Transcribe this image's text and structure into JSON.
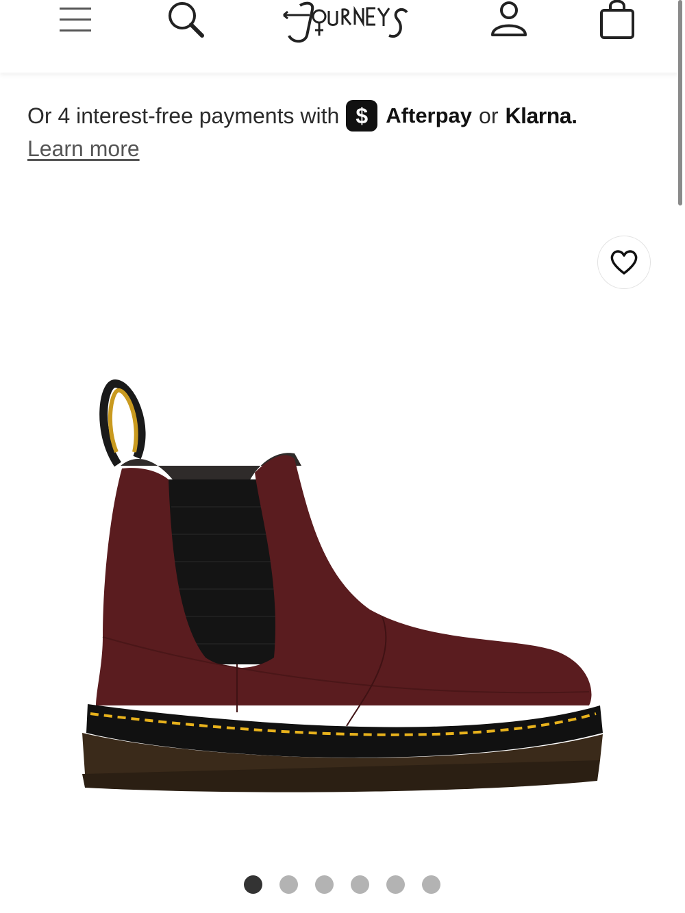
{
  "header": {
    "menu_icon": "hamburger-menu-icon",
    "search_icon": "search-icon",
    "logo_alt": "Journeys",
    "account_icon": "account-icon",
    "bag_icon": "shopping-bag-icon"
  },
  "payments": {
    "prefix_text": "Or 4 interest-free payments with",
    "cash_icon": "$",
    "afterpay_label": "Afterpay",
    "or_text": "or",
    "klarna_label": "Klarna.",
    "learn_more": "Learn more"
  },
  "product": {
    "favorite_icon": "heart-icon",
    "image_description": "product-image",
    "carousel": {
      "total": 6,
      "active_index": 0
    }
  },
  "colors": {
    "leather": "#5a1c1f",
    "sole": "#3a2a1a",
    "stitching": "#e8b21c",
    "active_dot": "#333333",
    "inactive_dot": "#b3b3b3"
  }
}
